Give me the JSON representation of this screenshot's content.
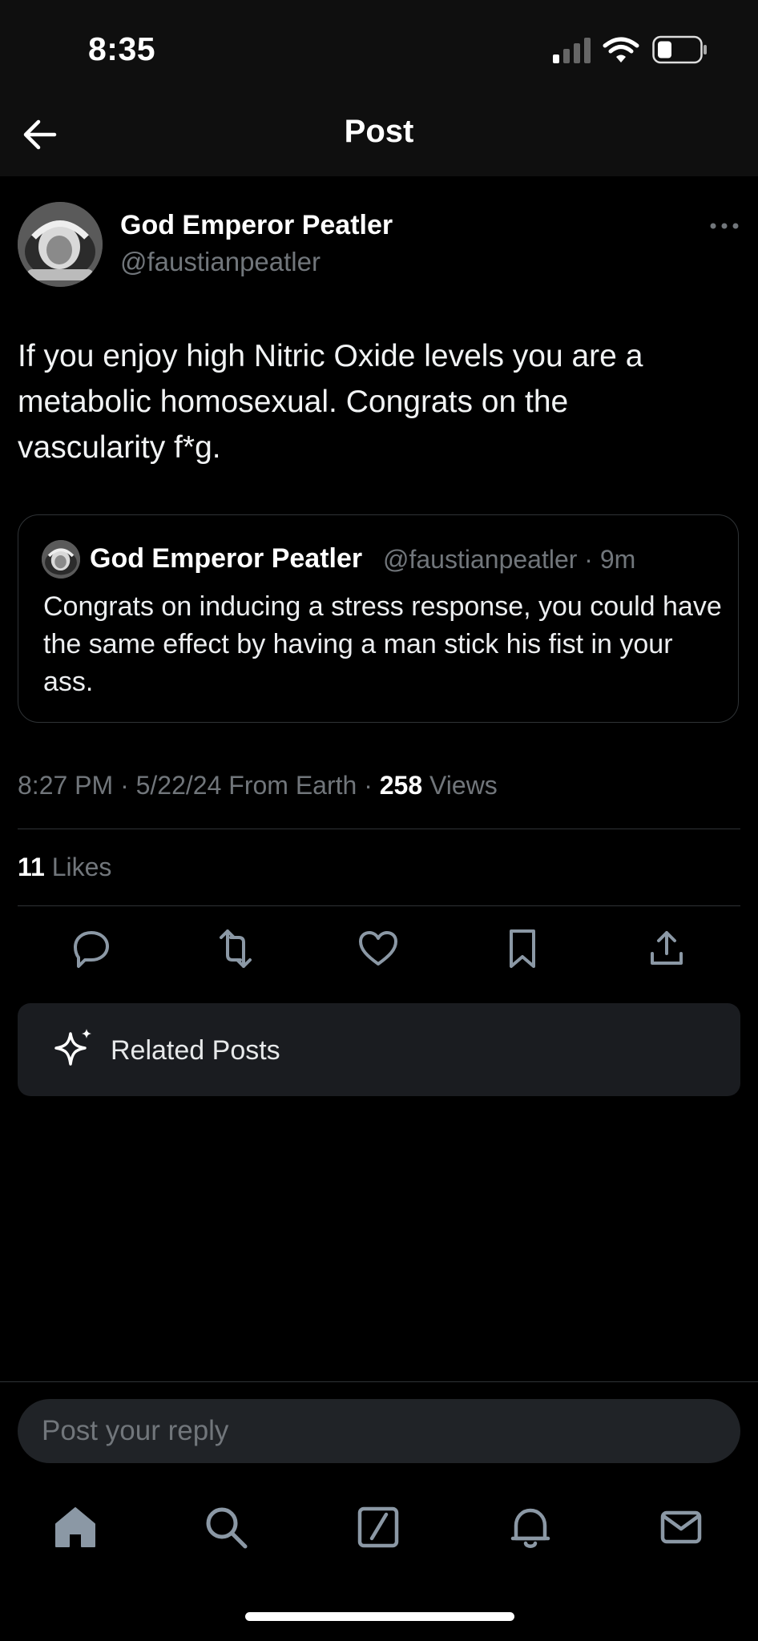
{
  "status_bar": {
    "time": "8:35"
  },
  "header": {
    "title": "Post"
  },
  "post": {
    "author_name": "God Emperor Peatler",
    "author_handle": "@faustianpeatler",
    "text": "If you enjoy high Nitric Oxide levels you are a metabolic homosexual. Congrats on the vascularity f*g.",
    "quoted": {
      "author_name": "God Emperor Peatler",
      "author_handle_time": "@faustianpeatler · 9m",
      "text": "Congrats on inducing a stress response, you could have the same effect by having a man stick his fist in your ass."
    },
    "meta_prefix": "8:27 PM · 5/22/24 From Earth · ",
    "views_count": "258",
    "views_label": " Views",
    "likes_count": "11",
    "likes_label": " Likes"
  },
  "actions": [
    "reply-icon",
    "repost-icon",
    "like-icon",
    "bookmark-icon",
    "share-icon"
  ],
  "related": {
    "label": "Related Posts"
  },
  "reply": {
    "placeholder": "Post your reply"
  },
  "bottom_nav": [
    "home-icon",
    "search-icon",
    "grok-icon",
    "notifications-icon",
    "messages-icon"
  ]
}
